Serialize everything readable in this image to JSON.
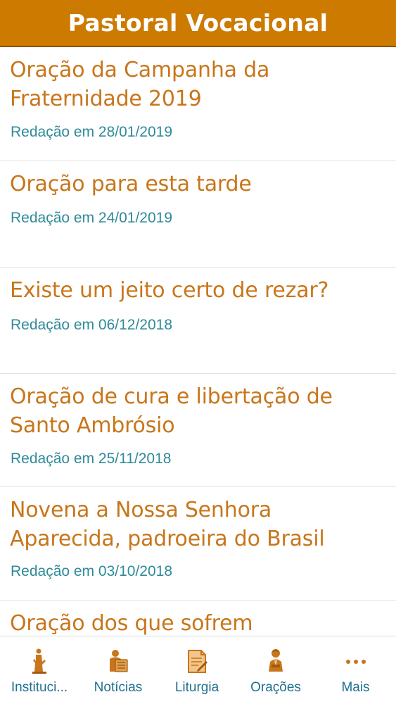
{
  "header": {
    "title": "Pastoral Vocacional"
  },
  "articles": [
    {
      "title": "Oração da Campanha da Fraternidade 2019",
      "date": "Redação em 28/01/2019"
    },
    {
      "title": "Oração para esta tarde",
      "date": "Redação em 24/01/2019"
    },
    {
      "title": "Existe um jeito certo de rezar?",
      "date": "Redação em 06/12/2018"
    },
    {
      "title": "Oração de cura e libertação de Santo Ambrósio",
      "date": "Redação em 25/11/2018"
    },
    {
      "title": "Novena a Nossa Senhora Aparecida, padroeira do Brasil",
      "date": "Redação em 03/10/2018"
    },
    {
      "title": "Oração dos que sofrem",
      "date": ""
    }
  ],
  "tabs": [
    {
      "label": "Instituci...",
      "icon": "statue-icon"
    },
    {
      "label": "Notícias",
      "icon": "newspaper-icon"
    },
    {
      "label": "Liturgia",
      "icon": "document-icon"
    },
    {
      "label": "Orações",
      "icon": "praying-person-icon"
    },
    {
      "label": "Mais",
      "icon": "more-icon"
    }
  ],
  "colors": {
    "header_bg": "#cc7a00",
    "title_text": "#c8761b",
    "date_text": "#2f8a99",
    "tab_label": "#1f6f8f",
    "icon": "#c8761b"
  }
}
